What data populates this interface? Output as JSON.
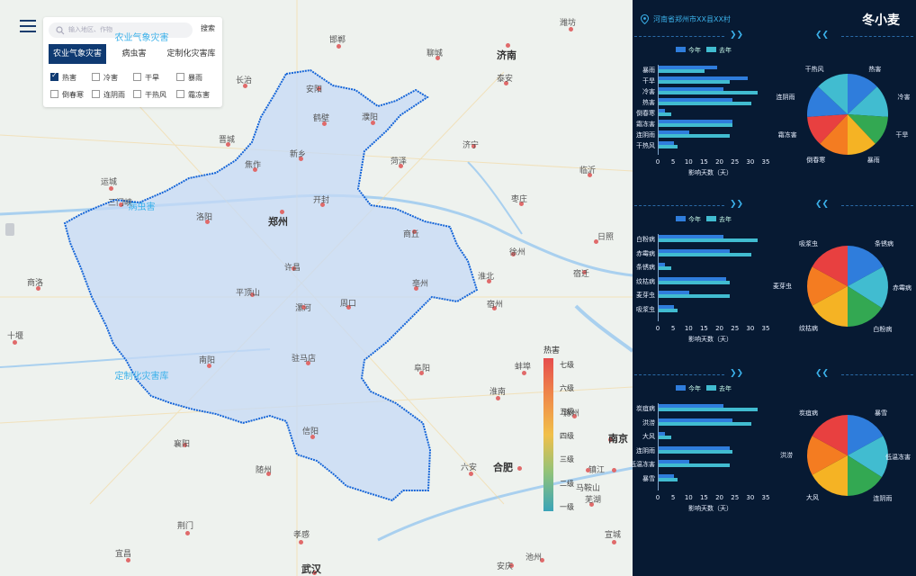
{
  "search": {
    "placeholder": "输入地区、作物",
    "button": "搜索"
  },
  "tabs": [
    "农业气象灾害",
    "病虫害",
    "定制化灾害库"
  ],
  "active_tab": 0,
  "checkboxes": [
    {
      "label": "热害",
      "checked": true
    },
    {
      "label": "冷害",
      "checked": false
    },
    {
      "label": "干旱",
      "checked": false
    },
    {
      "label": "暴雨",
      "checked": false
    },
    {
      "label": "倒春寒",
      "checked": false
    },
    {
      "label": "连阴雨",
      "checked": false
    },
    {
      "label": "干热风",
      "checked": false
    },
    {
      "label": "霜冻害",
      "checked": false
    }
  ],
  "cities": [
    "邯郸",
    "济南",
    "聊城",
    "泰安",
    "长治",
    "安阳",
    "鹤壁",
    "濮阳",
    "晋城",
    "焦作",
    "新乡",
    "济宁",
    "菏泽",
    "临沂",
    "运城",
    "三门峡",
    "开封",
    "洛阳",
    "郑州",
    "商丘",
    "枣庄",
    "徐州",
    "宿迁",
    "许昌",
    "平顶山",
    "商洛",
    "淮北",
    "漯河",
    "周口",
    "宿州",
    "亳州",
    "十堰",
    "南阳",
    "驻马店",
    "阜阳",
    "蚌埠",
    "滁州",
    "淮南",
    "信阳",
    "襄阳",
    "六安",
    "合肥",
    "随州",
    "荆门",
    "孝感",
    "宜昌",
    "武汉",
    "安庆",
    "池州",
    "南京",
    "镇江",
    "马鞍山",
    "芜湖",
    "宣城",
    "潍坊",
    "日照"
  ],
  "legend": {
    "title": "热害",
    "levels": [
      "七级",
      "六级",
      "五级",
      "四级",
      "三级",
      "二级",
      "一级"
    ]
  },
  "panel": {
    "location": "河南省郑州市XX县XX村",
    "crop": "冬小麦",
    "series_names": [
      "今年",
      "去年"
    ],
    "xlabel": "影响天数（天）"
  },
  "chart_data": [
    {
      "type": "bar",
      "title": "农业气象灾害",
      "orientation": "horizontal",
      "categories": [
        "暴雨",
        "干旱",
        "冷害",
        "热害",
        "倒春寒",
        "霜冻害",
        "连阴雨",
        "干热风"
      ],
      "series": [
        {
          "name": "今年",
          "values": [
            19,
            29,
            21,
            24,
            2,
            24,
            10,
            5
          ]
        },
        {
          "name": "去年",
          "values": [
            15,
            23,
            32,
            30,
            4,
            24,
            23,
            6
          ]
        }
      ],
      "xticks": [
        0,
        5,
        10,
        15,
        20,
        25,
        30,
        35
      ],
      "xlim": [
        0,
        35
      ],
      "xlabel": "影响天数（天）"
    },
    {
      "type": "pie",
      "title": "农业气象灾害",
      "labels": [
        "热害",
        "冷害",
        "干旱",
        "暴雨",
        "倒春寒",
        "霜冻害",
        "连阴雨",
        "干热风"
      ],
      "values": [
        13,
        13,
        12,
        12,
        12,
        12,
        13,
        13
      ],
      "colors": [
        "#2f7ddc",
        "#41bcd0",
        "#33a852",
        "#f5b324",
        "#f47c21",
        "#e84040",
        "#2f7ddc",
        "#41bcd0"
      ]
    },
    {
      "type": "bar",
      "title": "病虫害",
      "orientation": "horizontal",
      "categories": [
        "白粉病",
        "赤霉病",
        "条锈病",
        "纹枯病",
        "麦芽虫",
        "吸浆虫"
      ],
      "series": [
        {
          "name": "今年",
          "values": [
            21,
            23,
            2,
            22,
            10,
            5
          ]
        },
        {
          "name": "去年",
          "values": [
            32,
            30,
            4,
            23,
            23,
            6
          ]
        }
      ],
      "xticks": [
        0,
        5,
        10,
        15,
        20,
        25,
        30,
        35
      ],
      "xlim": [
        0,
        35
      ],
      "xlabel": "影响天数（天）"
    },
    {
      "type": "pie",
      "title": "病虫害",
      "labels": [
        "条锈病",
        "赤霉病",
        "白粉病",
        "纹枯病",
        "麦芽虫",
        "吸浆虫"
      ],
      "values": [
        17,
        17,
        16,
        17,
        16,
        17
      ],
      "colors": [
        "#2f7ddc",
        "#41bcd0",
        "#33a852",
        "#f5b324",
        "#f47c21",
        "#e84040"
      ]
    },
    {
      "type": "bar",
      "title": "定制化灾害库",
      "orientation": "horizontal",
      "categories": [
        "炭疽病",
        "洪涝",
        "大风",
        "连阴雨",
        "低温冻害",
        "暴雪"
      ],
      "series": [
        {
          "name": "今年",
          "values": [
            21,
            24,
            2,
            23,
            10,
            5
          ]
        },
        {
          "name": "去年",
          "values": [
            32,
            30,
            4,
            24,
            23,
            6
          ]
        }
      ],
      "xticks": [
        0,
        5,
        10,
        15,
        20,
        25,
        30,
        35
      ],
      "xlim": [
        0,
        35
      ],
      "xlabel": "影响天数（天）"
    },
    {
      "type": "pie",
      "title": "定制化灾害库",
      "labels": [
        "暴雪",
        "低温冻害",
        "连阴雨",
        "大风",
        "洪涝",
        "炭疽病"
      ],
      "values": [
        17,
        17,
        16,
        17,
        16,
        17
      ],
      "colors": [
        "#2f7ddc",
        "#41bcd0",
        "#33a852",
        "#f5b324",
        "#f47c21",
        "#e84040"
      ]
    }
  ]
}
